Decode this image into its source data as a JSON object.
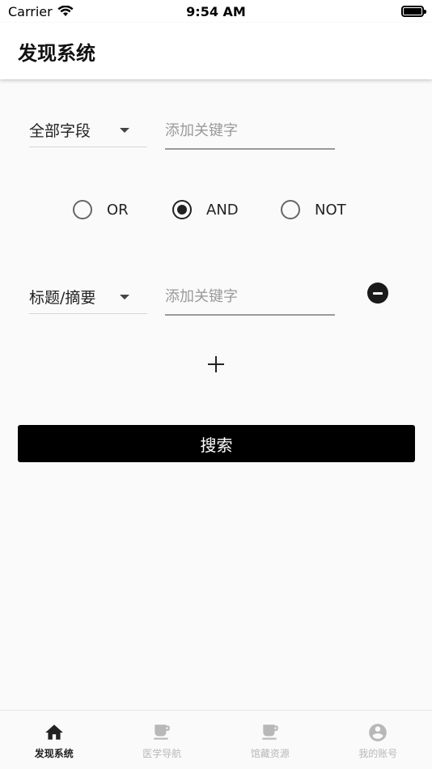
{
  "status_bar": {
    "carrier": "Carrier",
    "time": "9:54 AM"
  },
  "header": {
    "title": "发现系统"
  },
  "rows": [
    {
      "field": "全部字段",
      "placeholder": "添加关键字"
    },
    {
      "field": "标题/摘要",
      "placeholder": "添加关键字"
    }
  ],
  "operators": {
    "options": [
      "OR",
      "AND",
      "NOT"
    ],
    "selected": "AND"
  },
  "search_button": "搜索",
  "bottom_nav": {
    "items": [
      {
        "label": "发现系统",
        "icon": "home-icon",
        "active": true
      },
      {
        "label": "医学导航",
        "icon": "cup-icon",
        "active": false
      },
      {
        "label": "馆藏资源",
        "icon": "cup-icon",
        "active": false
      },
      {
        "label": "我的账号",
        "icon": "account-circle-icon",
        "active": false
      }
    ]
  },
  "colors": {
    "active_nav": "#222222",
    "inactive_nav": "#b8b8b8",
    "button_bg": "#000000"
  }
}
